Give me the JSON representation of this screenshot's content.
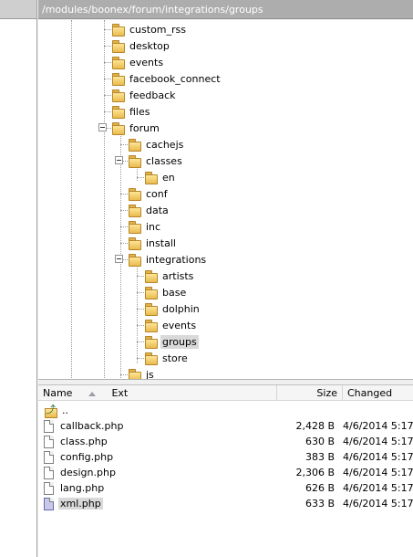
{
  "path": "/modules/boonex/forum/integrations/groups",
  "tree": [
    {
      "label": "custom_rss",
      "depth": 0,
      "expanded": false
    },
    {
      "label": "desktop",
      "depth": 0,
      "expanded": false
    },
    {
      "label": "events",
      "depth": 0,
      "expanded": false
    },
    {
      "label": "facebook_connect",
      "depth": 0,
      "expanded": false
    },
    {
      "label": "feedback",
      "depth": 0,
      "expanded": false
    },
    {
      "label": "files",
      "depth": 0,
      "expanded": false
    },
    {
      "label": "forum",
      "depth": 0,
      "expanded": true
    },
    {
      "label": "cachejs",
      "depth": 1,
      "expanded": false
    },
    {
      "label": "classes",
      "depth": 1,
      "expanded": true
    },
    {
      "label": "en",
      "depth": 2,
      "expanded": false
    },
    {
      "label": "conf",
      "depth": 1,
      "expanded": false
    },
    {
      "label": "data",
      "depth": 1,
      "expanded": false
    },
    {
      "label": "inc",
      "depth": 1,
      "expanded": false
    },
    {
      "label": "install",
      "depth": 1,
      "expanded": false
    },
    {
      "label": "integrations",
      "depth": 1,
      "expanded": true
    },
    {
      "label": "artists",
      "depth": 2,
      "expanded": false
    },
    {
      "label": "base",
      "depth": 2,
      "expanded": false
    },
    {
      "label": "dolphin",
      "depth": 2,
      "expanded": false
    },
    {
      "label": "events",
      "depth": 2,
      "expanded": false
    },
    {
      "label": "groups",
      "depth": 2,
      "expanded": false,
      "selected": true
    },
    {
      "label": "store",
      "depth": 2,
      "expanded": false
    },
    {
      "label": "js",
      "depth": 1,
      "expanded": false
    }
  ],
  "columns": {
    "name": "Name",
    "ext": "Ext",
    "size": "Size",
    "changed": "Changed"
  },
  "files": [
    {
      "name": "..",
      "type": "updir",
      "size": "",
      "changed": ""
    },
    {
      "name": "callback.php",
      "type": "file",
      "size": "2,428 B",
      "changed": "4/6/2014 5:17"
    },
    {
      "name": "class.php",
      "type": "file",
      "size": "630 B",
      "changed": "4/6/2014 5:17"
    },
    {
      "name": "config.php",
      "type": "file",
      "size": "383 B",
      "changed": "4/6/2014 5:17"
    },
    {
      "name": "design.php",
      "type": "file",
      "size": "2,306 B",
      "changed": "4/6/2014 5:17"
    },
    {
      "name": "lang.php",
      "type": "file",
      "size": "626 B",
      "changed": "4/6/2014 5:17"
    },
    {
      "name": "xml.php",
      "type": "xml",
      "size": "633 B",
      "changed": "4/6/2014 5:17",
      "selected": true
    }
  ]
}
